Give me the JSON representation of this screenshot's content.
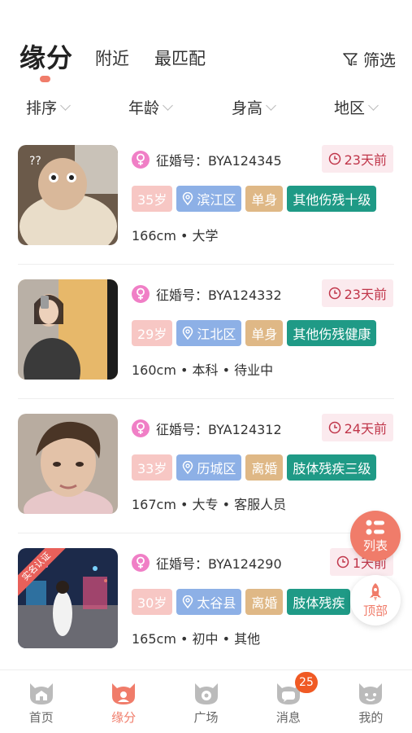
{
  "header": {
    "tab_main": "缘分",
    "tab_nearby": "附近",
    "tab_best_match": "最匹配",
    "filter_label": "筛选"
  },
  "sort_bar": {
    "sort": "排序",
    "age": "年龄",
    "height": "身高",
    "region": "地区"
  },
  "profiles": [
    {
      "id_label": "征婚号：BYA124345",
      "time_ago": "23天前",
      "age": "35岁",
      "location": "滨江区",
      "marital_status": "单身",
      "disability": "其他伤残十级",
      "meta": "166cm • 大学",
      "verified": false
    },
    {
      "id_label": "征婚号：BYA124332",
      "time_ago": "23天前",
      "age": "29岁",
      "location": "江北区",
      "marital_status": "单身",
      "disability": "其他伤残健康",
      "meta": "160cm • 本科 • 待业中",
      "verified": false
    },
    {
      "id_label": "征婚号：BYA124312",
      "time_ago": "24天前",
      "age": "33岁",
      "location": "历城区",
      "marital_status": "离婚",
      "disability": "肢体残疾三级",
      "meta": "167cm • 大专 • 客服人员",
      "verified": false
    },
    {
      "id_label": "征婚号：BYA124290",
      "time_ago": "1天前",
      "age": "30岁",
      "location": "太谷县",
      "marital_status": "离婚",
      "disability": "肢体残疾",
      "meta": "165cm • 初中 • 其他",
      "verified": true,
      "verified_label": "实名认证"
    }
  ],
  "fab": {
    "list_label": "列表",
    "top_label": "顶部"
  },
  "bottom_nav": {
    "home": "首页",
    "fate": "缘分",
    "square": "广场",
    "messages": "消息",
    "messages_badge": "25",
    "mine": "我的"
  },
  "colors": {
    "accent": "#f07c6a",
    "gender_female": "#f07fc6",
    "tag_age": "#f7c7c4",
    "tag_location": "#8db0e6",
    "tag_status": "#dfb886",
    "tag_disability": "#1f9a86",
    "time_text": "#c0364a",
    "badge": "#f05a24"
  }
}
